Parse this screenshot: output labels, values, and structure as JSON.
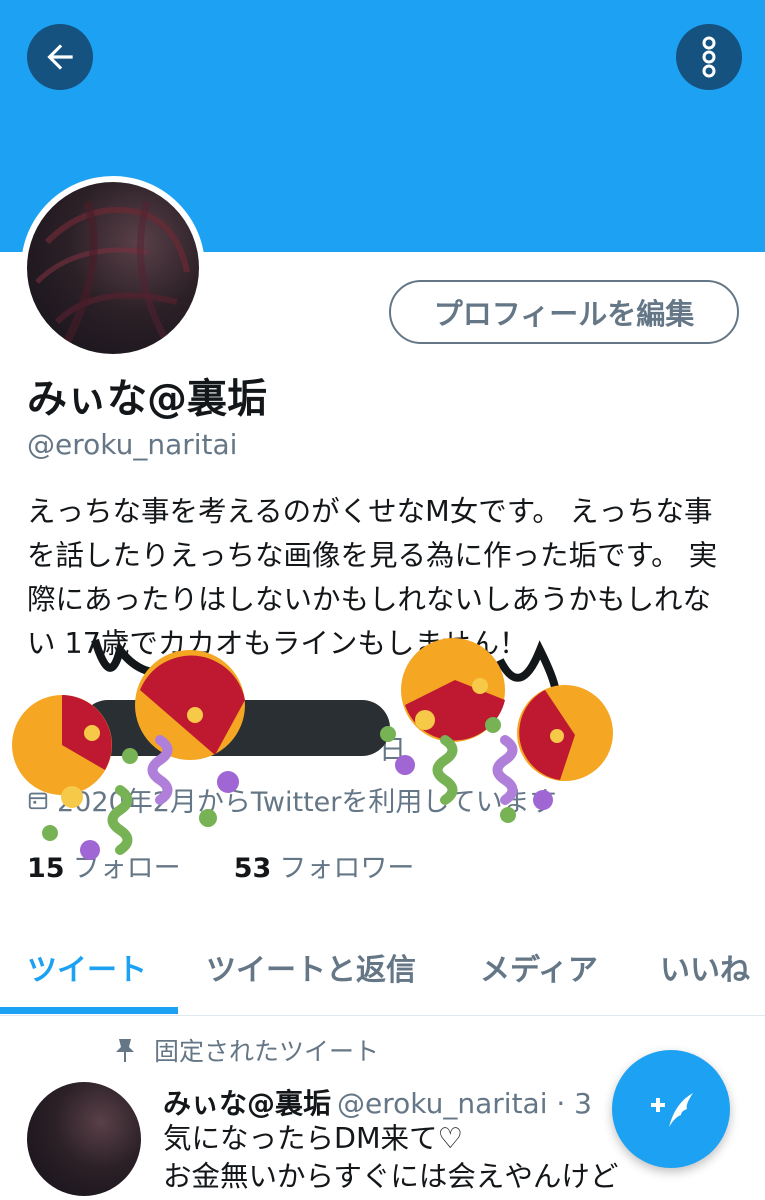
{
  "header": {
    "back_icon": "arrow-left-icon",
    "more_icon": "more-vertical-icon",
    "banner_color": "#1da1f2"
  },
  "profile": {
    "edit_button": "プロフィールを編集",
    "display_name": "みぃな@裏垢",
    "handle": "@eroku_naritai",
    "bio": "えっちな事を考えるのがくせなM女です。 えっちな事を話したりえっちな画像を見る為に作った垢です。 実際にあったりはしないかもしれないしあうかもしれない 17歳でカカオもラインもしません！",
    "location": "日",
    "joined": "2020年2月からTwitterを利用しています",
    "following_count": "15",
    "following_label": "フォロー",
    "followers_count": "53",
    "followers_label": "フォロワー"
  },
  "tabs": [
    {
      "label": "ツイート",
      "active": true
    },
    {
      "label": "ツイートと返信",
      "active": false
    },
    {
      "label": "メディア",
      "active": false
    },
    {
      "label": "いいね",
      "active": false
    }
  ],
  "pinned_tweet": {
    "pinned_label": "固定されたツイート",
    "author_name": "みぃな@裏垢",
    "author_handle": "@eroku_naritai · 3",
    "text_line1": "気になったらDM来て♡",
    "text_line2": "お金無いからすぐには会えやんけど"
  },
  "fab": {
    "icon": "compose-tweet-icon"
  },
  "accent_color": "#1da1f2",
  "muted_color": "#657786"
}
